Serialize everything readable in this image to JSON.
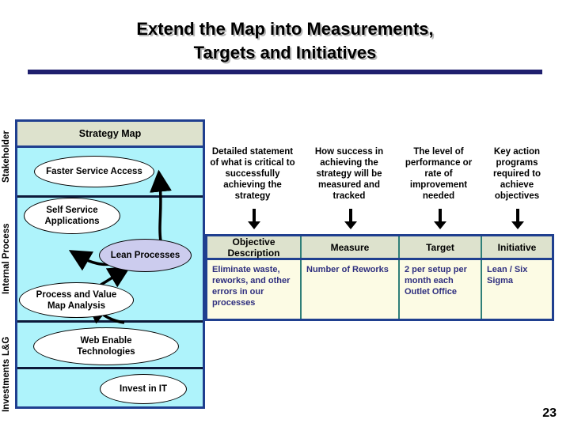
{
  "slide": {
    "title_line1": "Extend the Map into Measurements,",
    "title_line2": "Targets and Initiatives",
    "page_number": "23",
    "accent_navy": "#1f3f8f",
    "rule_color": "#1f1f6e",
    "map_fill": "#aef3fb",
    "header_fill": "#dde2cd",
    "table_fill": "#fcfbe4",
    "table_text": "#2f2f7f",
    "lean_fill": "#ccccee"
  },
  "strategy_map": {
    "header": "Strategy Map",
    "perspectives": [
      {
        "label": "Stakeholder"
      },
      {
        "label": "Internal Process"
      },
      {
        "label": "L&G"
      },
      {
        "label": "Investments"
      }
    ],
    "nodes": [
      {
        "label": "Faster Service Access",
        "fill": "white"
      },
      {
        "label": "Self Service\nApplications",
        "line1": "Self Service",
        "line2": "Applications",
        "fill": "white"
      },
      {
        "label": "Lean Processes",
        "fill": "lavender"
      },
      {
        "label": "Process and Value\nMap Analysis",
        "line1": "Process and Value",
        "line2": "Map Analysis",
        "fill": "white"
      },
      {
        "label": "Web Enable\nTechnologies",
        "line1": "Web Enable",
        "line2": "Technologies",
        "fill": "white"
      },
      {
        "label": "Invest in IT",
        "fill": "white"
      }
    ]
  },
  "columns": {
    "descriptions": [
      "Detailed statement of what is critical to successfully achieving the strategy",
      "How success in achieving the strategy will be measured and tracked",
      "The level of performance or rate of improvement needed",
      "Key action programs required to achieve objectives"
    ]
  },
  "table": {
    "headers": [
      "Objective Description",
      "Measure",
      "Target",
      "Initiative"
    ],
    "rows": [
      {
        "objective_description": "Eliminate waste, reworks, and other errors in our processes",
        "measure": "Number of Reworks",
        "target": "2 per setup per month each Outlet Office",
        "initiative": "Lean / Six Sigma"
      }
    ]
  }
}
